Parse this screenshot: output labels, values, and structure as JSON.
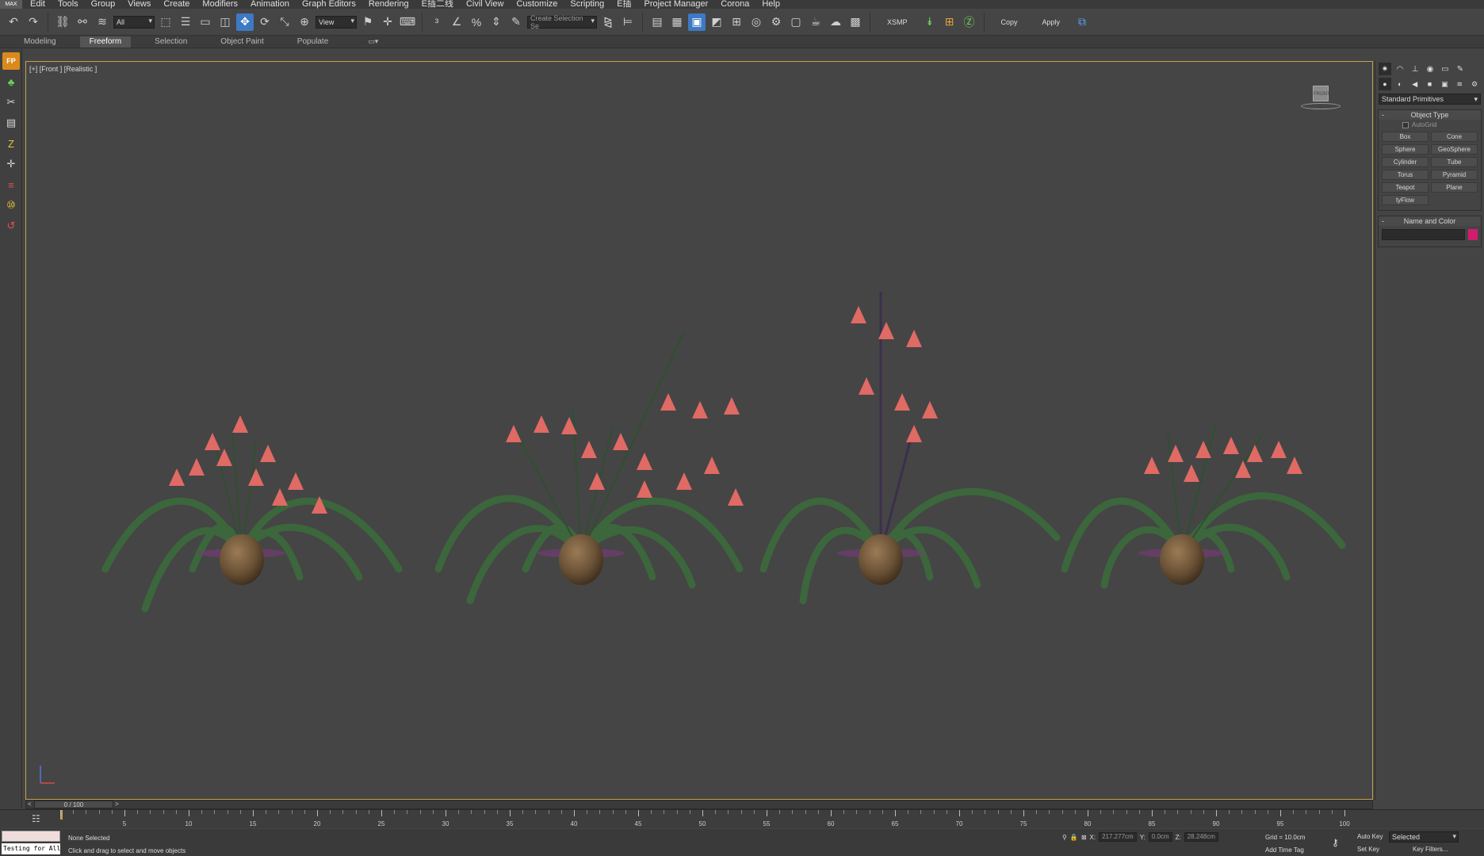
{
  "menu": {
    "logo": "MAX",
    "items": [
      "Edit",
      "Tools",
      "Group",
      "Views",
      "Create",
      "Modifiers",
      "Animation",
      "Graph Editors",
      "Rendering",
      "E插二线",
      "Civil View",
      "Customize",
      "Scripting",
      "E插",
      "Project Manager",
      "Corona",
      "Help"
    ]
  },
  "toolbar": {
    "filter_value": "All",
    "refcoord_value": "View",
    "selection_set_placeholder": "Create Selection Se",
    "xsmp_label": "XSMP",
    "copy_label": "Copy",
    "apply_label": "Apply"
  },
  "ribbon": {
    "tabs": [
      "Modeling",
      "Freeform",
      "Selection",
      "Object Paint",
      "Populate"
    ],
    "active_tab": "Freeform"
  },
  "viewport": {
    "label": "[+] [Front ] [Realistic ]"
  },
  "timeline": {
    "prev_label": "<",
    "next_label": ">",
    "frame_readout": "0 / 100",
    "ticks": [
      "5",
      "10",
      "15",
      "20",
      "25",
      "30",
      "35",
      "40",
      "45",
      "50",
      "55",
      "60",
      "65",
      "70",
      "75",
      "80",
      "85",
      "90",
      "95",
      "100"
    ]
  },
  "status": {
    "maxscript_output": "Testing for All",
    "selection": "None Selected",
    "prompt": "Click and drag to select and move objects",
    "x_value": "217.277cm",
    "y_value": "0.0cm",
    "z_value": "28.248cm",
    "x_label": "X:",
    "y_label": "Y:",
    "z_label": "Z:",
    "grid": "Grid = 10.0cm",
    "add_time_tag": "Add Time Tag",
    "auto_key": "Auto Key",
    "set_key": "Set Key",
    "selected_value": "Selected",
    "key_filters": "Key Filters..."
  },
  "command_panel": {
    "dropdown_value": "Standard Primitives",
    "object_type_title": "Object Type",
    "autogrid_label": "AutoGrid",
    "buttons": [
      "Box",
      "Cone",
      "Sphere",
      "GeoSphere",
      "Cylinder",
      "Tube",
      "Torus",
      "Pyramid",
      "Teapot",
      "Plane",
      "tyFlow"
    ],
    "name_color_title": "Name and Color",
    "object_color": "#d21c6e"
  },
  "colors": {
    "viewport_bg": "#454545",
    "viewport_border": "#c8a14a",
    "active_tool": "#3e79c4",
    "flower": "#e06a64",
    "leaf": "#3e6b3e",
    "pot": "#6b5236"
  }
}
